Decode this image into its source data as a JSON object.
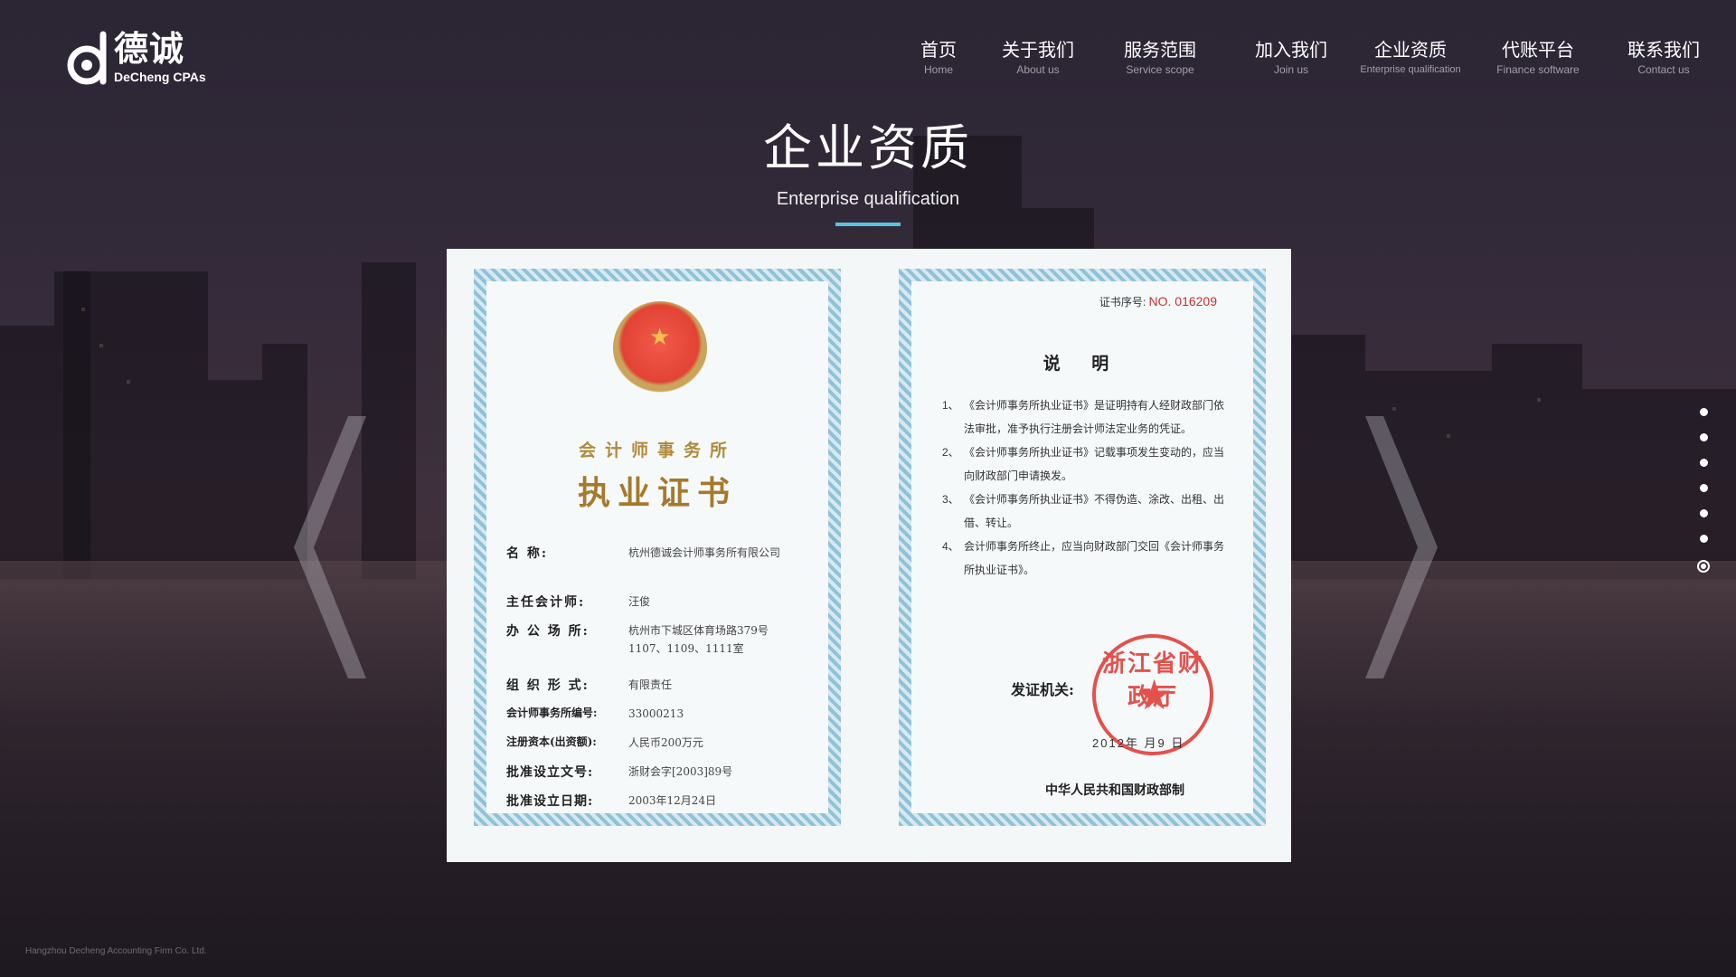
{
  "brand": {
    "name_cn": "德诚",
    "name_en": "DeCheng CPAs"
  },
  "nav": [
    {
      "cn": "首页",
      "en": "Home"
    },
    {
      "cn": "关于我们",
      "en": "About us"
    },
    {
      "cn": "服务范围",
      "en": "Service scope"
    },
    {
      "cn": "加入我们",
      "en": "Join us"
    },
    {
      "cn": "企业资质",
      "en": "Enterprise qualification"
    },
    {
      "cn": "代账平台",
      "en": "Finance software"
    },
    {
      "cn": "联系我们",
      "en": "Contact us"
    }
  ],
  "heading": {
    "cn": "企业资质",
    "en": "Enterprise qualification"
  },
  "certificate": {
    "left": {
      "subtitle": "会计师事务所",
      "title": "执业证书",
      "fields": [
        {
          "label": "名        称:",
          "value": "杭州德诚会计师事务所有限公司"
        },
        {
          "label": "主任会计师:",
          "value": "汪俊"
        },
        {
          "label": "办 公 场 所:",
          "value": "杭州市下城区体育场路379号\n1107、1109、1111室"
        },
        {
          "label": "组 织 形 式:",
          "value": "有限责任"
        },
        {
          "label": "会计师事务所编号:",
          "value": "33000213"
        },
        {
          "label": "注册资本(出资额):",
          "value": "人民币200万元"
        },
        {
          "label": "批准设立文号:",
          "value": "浙财会字[2003]89号"
        },
        {
          "label": "批准设立日期:",
          "value": "2003年12月24日"
        }
      ]
    },
    "right": {
      "serial_label": "证书序号:",
      "serial_no": "NO. 016209",
      "notes_title": "说 明",
      "notes": [
        {
          "num": "1、",
          "text": "《会计师事务所执业证书》是证明持有人经财政部门依法审批，准予执行注册会计师法定业务的凭证。"
        },
        {
          "num": "2、",
          "text": "《会计师事务所执业证书》记载事项发生变动的，应当向财政部门申请换发。"
        },
        {
          "num": "3、",
          "text": "《会计师事务所执业证书》不得伪造、涂改、出租、出借、转让。"
        },
        {
          "num": "4、",
          "text": "会计师事务所终止，应当向财政部门交回《会计师事务所执业证书》。"
        }
      ],
      "issuer_label": "发证机关:",
      "issue_date": "2012年  月9 日",
      "seal_text": "浙江省财政厅",
      "ministry": "中华人民共和国财政部制"
    }
  },
  "carousel": {
    "dot_count": 7,
    "active_index": 6
  },
  "footer": "Hangzhou Decheng Accounting Firm Co. Ltd."
}
